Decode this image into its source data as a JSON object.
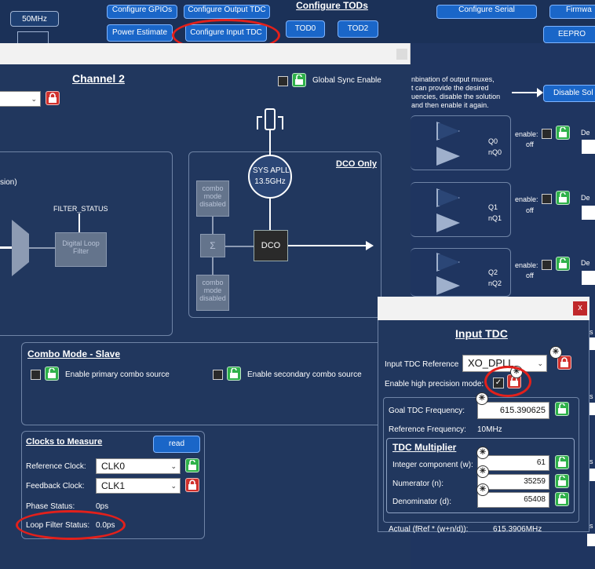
{
  "top": {
    "freq_btn": "50MHz",
    "configure_gpios": "Configure GPIOs",
    "configure_output_tdc": "Configure Output TDC",
    "configure_tods": "Configure TODs",
    "power_estimate": "Power Estimate",
    "configure_input_tdc": "Configure Input TDC",
    "tod0": "TOD0",
    "tod2": "TOD2",
    "configure_serial": "Configure Serial",
    "firmware": "Firmwa",
    "eeprom": "EEPRO"
  },
  "channel": {
    "title": "Channel 2",
    "global_sync": "Global Sync Enable",
    "left_frag": "sion)",
    "filter_status": "FILTER_STATUS",
    "digital_loop_filter": "Digital Loop Filter",
    "dco_only": "DCO Only",
    "sys_apll_line1": "SYS APLL",
    "sys_apll_line2": "13.5GHz",
    "combo_disabled_top": "combo mode disabled",
    "sigma": "Σ",
    "dco": "DCO",
    "combo_disabled_bottom": "combo mode disabled"
  },
  "combo": {
    "title": "Combo Mode - Slave",
    "primary": "Enable primary combo source",
    "secondary": "Enable secondary combo source"
  },
  "clocks": {
    "title": "Clocks to Measure",
    "read_btn": "read",
    "reference_label": "Reference Clock:",
    "reference_value": "CLK0",
    "feedback_label": "Feedback Clock:",
    "feedback_value": "CLK1",
    "phase_label": "Phase Status:",
    "phase_value": "0ps",
    "loop_label": "Loop Filter Status:",
    "loop_value": "0.0ps"
  },
  "right": {
    "info_line1": "nbination of output muxes,",
    "info_line2": "t can provide the desired",
    "info_line3": "uencies, disable the solution",
    "info_line4": "and then enable it again.",
    "disable_btn": "Disable Sol",
    "outputs": [
      {
        "q": "Q0",
        "nq": "nQ0",
        "enable": "enable:",
        "off": "off",
        "des": "De"
      },
      {
        "q": "Q1",
        "nq": "nQ1",
        "enable": "enable:",
        "off": "off",
        "des": "De"
      },
      {
        "q": "Q2",
        "nq": "nQ2",
        "enable": "enable:",
        "off": "off",
        "des": "De"
      }
    ],
    "side_es": "es"
  },
  "tdc": {
    "close": "x",
    "title": "Input TDC",
    "reference_label": "Input TDC Reference",
    "reference_value": "XO_DPLL",
    "high_precision_label": "Enable high precision mode:",
    "goal_label": "Goal TDC Frequency:",
    "goal_value": "615.390625",
    "ref_freq_label": "Reference Frequency:",
    "ref_freq_value": "10MHz",
    "multiplier_title": "TDC Multiplier",
    "integer_label": "Integer component (w):",
    "integer_value": "61",
    "numerator_label": "Numerator (n):",
    "numerator_value": "35259",
    "denominator_label": "Denominator (d):",
    "denominator_value": "65408",
    "actual_label": "Actual (fRef * (w+n/d)):",
    "actual_value": "615.3906MHz"
  },
  "colors": {
    "background": "#20365f",
    "button": "#1a66c8",
    "highlight_ring": "#e3201b",
    "lock_green": "#2fb14a",
    "lock_red": "#d0312d"
  }
}
